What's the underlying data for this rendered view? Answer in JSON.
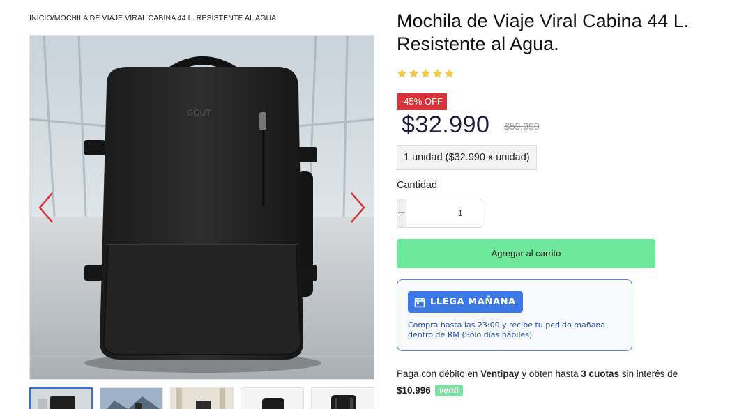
{
  "breadcrumb": {
    "text": "INICIO/MOCHILA DE VIAJE VIRAL CABINA 44 L. RESISTENTE AL AGUA."
  },
  "product": {
    "title": "Mochila de Viaje Viral Cabina 44 L. Resistente al Agua.",
    "rating": 5,
    "star_color": "#f5c842",
    "discount_label": "-45% OFF",
    "price": "$32.990",
    "old_price": "$59.990",
    "unit_text": "1 unidad ($32.990 x unidad)",
    "bag_logo": "GOUT"
  },
  "quantity": {
    "label": "Cantidad",
    "value": "1",
    "minus": "−",
    "plus": "+"
  },
  "cart_button": {
    "label": "Agregar al carrito",
    "color": "#6ee89a"
  },
  "shipping": {
    "badge": "LLEGA MAÑANA",
    "description": "Compra hasta las 23:00 y recibe tu pedido mañana dentro de RM (Sólo días hábiles)",
    "icon": "calendar-icon"
  },
  "payment": {
    "prefix": "Paga con débito en",
    "provider": "Ventipay",
    "middle": "y obten hasta",
    "installments": "3 cuotas",
    "suffix": "sin interés de",
    "amount": "$10.996",
    "brand_badge": "venti"
  },
  "gallery": {
    "thumbnail_count": 5,
    "active_index": 0
  }
}
